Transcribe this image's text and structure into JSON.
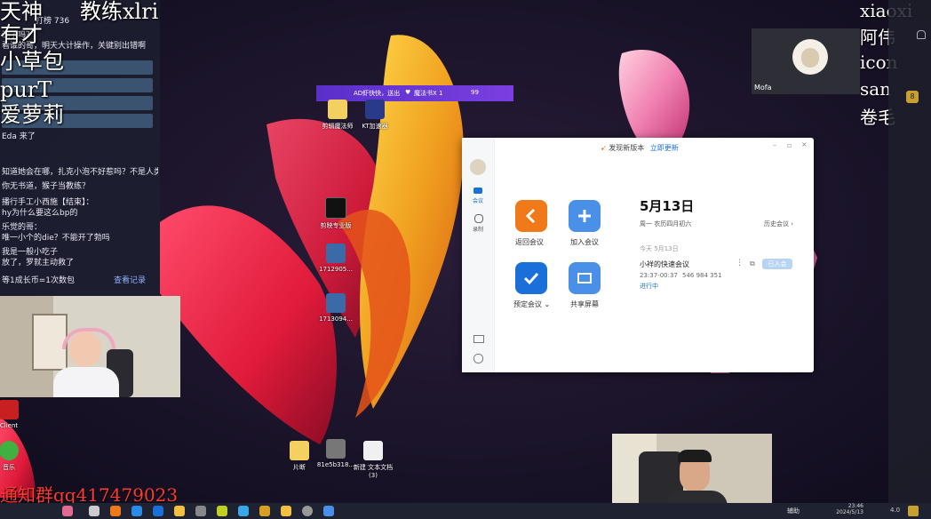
{
  "overlay": {
    "names_left": [
      "天神",
      "有才",
      "小草包",
      "purT",
      "爱萝莉"
    ],
    "coach_label": "教练xlri",
    "names_right": [
      "xiaoxi",
      "阿伟",
      "icon",
      "san",
      "卷毛"
    ],
    "qq_group": "通知群qq417479023",
    "right_badge": "8"
  },
  "chat": {
    "lines": [
      "打榜 736",
      "说了吗？",
      "看谁的哥，明天大计操作，关键别出错啊",
      "Eda 来了",
      "知道她会在哪，扎克小泡不好惹吗？不是人类？",
      "你无书道，猴子当教练？",
      "播行手工小西施【结束】：",
      "hy为什么要这么bp的",
      "乐觉的哥：",
      "唯一小个的die？不能开了勃吗",
      "我是一般小吃子",
      "放了，罗就主动救了"
    ],
    "footer_left": "等1成长币=1次数包",
    "footer_right": "查看记录"
  },
  "banner": {
    "text": "AD虾快快，送出",
    "gift": "魔法书X 1",
    "count": "99"
  },
  "desktop_icons": [
    {
      "label": "剪辑魔法师"
    },
    {
      "label": "KT加速器"
    },
    {
      "label": "剪映专业版"
    },
    {
      "label": "1712905..."
    },
    {
      "label": "1713094..."
    },
    {
      "label": "片断"
    },
    {
      "label": "81e5b318..."
    },
    {
      "label": "新建 文本文档 (3)"
    },
    {
      "label": "Client"
    },
    {
      "label": "音乐"
    }
  ],
  "meeting": {
    "update_notice": "发现新版本",
    "update_link": "立即更新",
    "sidebar": {
      "meetings": "会议",
      "recordings": "录制"
    },
    "actions": [
      {
        "label": "返回会议",
        "icon": "chevron-left-icon",
        "color": "#f07a1a"
      },
      {
        "label": "加入会议",
        "icon": "plus-icon",
        "color": "#4a90e8"
      },
      {
        "label": "预定会议",
        "icon": "check-icon",
        "color": "#1a6fd8"
      },
      {
        "label": "共享屏幕",
        "icon": "share-screen-icon",
        "color": "#4a90e8"
      }
    ],
    "date": "5月13日",
    "lunar": "周一 农历四月初六",
    "history": "历史会议",
    "today_label": "今天 5月13日",
    "item": {
      "title": "小祥的快速会议",
      "time": "23:37-00:37",
      "id": "546 984 351",
      "status": "进行中",
      "enter": "已入会"
    }
  },
  "cams": {
    "top_right_name": "Mofa"
  },
  "taskbar": {
    "clock_time": "23:46",
    "clock_date": "2024/5/13",
    "tray_label": "辅助",
    "corner": "4.0"
  }
}
